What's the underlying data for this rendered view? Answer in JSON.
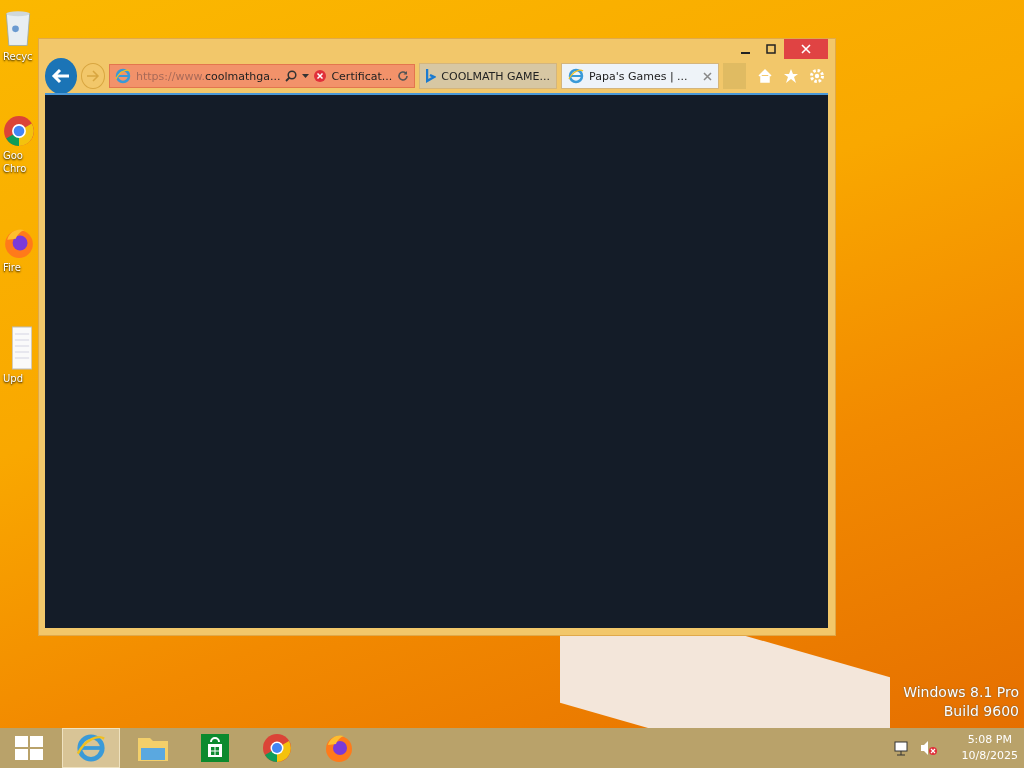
{
  "desktop_icons": [
    {
      "kind": "bin",
      "label": "Recyc"
    },
    {
      "kind": "chrome",
      "label": "Goo Chro"
    },
    {
      "kind": "firefox",
      "label": "Fire"
    },
    {
      "kind": "doc",
      "label": "Upd"
    }
  ],
  "browser": {
    "address": {
      "scheme": "https://www.",
      "host": "coolmathga..."
    },
    "certificate": "Certificat...",
    "tabs": [
      {
        "kind": "bing",
        "label": "COOLMATH GAME...",
        "selected": false
      },
      {
        "kind": "ie",
        "label": "Papa's Games | ...",
        "selected": true
      }
    ]
  },
  "watermark": [
    "Windows 8.1 Pro",
    "Build 9600"
  ],
  "taskbar": {
    "items": [
      {
        "kind": "ie",
        "selected": true
      },
      {
        "kind": "explorer",
        "selected": false
      },
      {
        "kind": "store",
        "selected": false
      },
      {
        "kind": "chrome",
        "selected": false
      },
      {
        "kind": "firefox",
        "selected": false
      }
    ],
    "time": "5:08 PM",
    "date": "10/8/2025"
  }
}
